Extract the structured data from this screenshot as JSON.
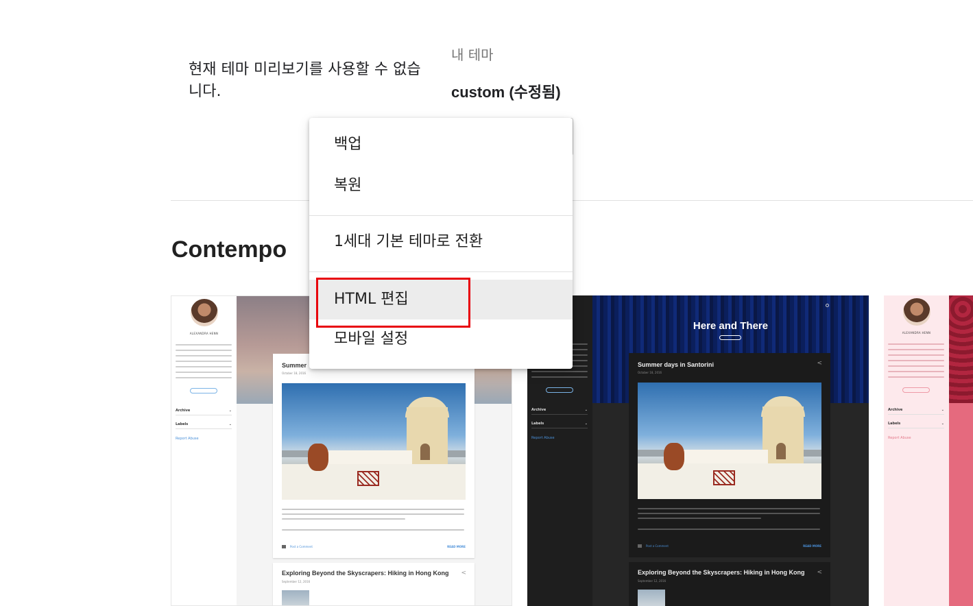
{
  "current_theme": {
    "no_preview_text": "현재 테마 미리보기를 사용할 수 없습니다.",
    "label": "내 테마",
    "name": "custom (수정됨)"
  },
  "theme_section": {
    "title": "Contempo"
  },
  "dropdown_menu": {
    "items": [
      {
        "label": "백업",
        "highlighted": false
      },
      {
        "label": "복원",
        "highlighted": false
      },
      {
        "label": "1세대 기본 테마로 전환",
        "highlighted": false
      },
      {
        "label": "HTML 편집",
        "highlighted": true
      },
      {
        "label": "모바일 설정",
        "highlighted": false
      }
    ]
  },
  "thumbnails": {
    "author_name": "ALEXANDRA HENN",
    "sidebar_archive": "Archive",
    "sidebar_labels": "Labels",
    "sidebar_report": "Report Abuse",
    "post_1_title_light": "Summer",
    "post_1_title": "Summer days in Santorini",
    "post_1_date": "October 18, 2016",
    "post_2_title": "Exploring Beyond the Skyscrapers: Hiking in Hong Kong",
    "post_2_date": "September 12, 2016",
    "dark_blog_title": "Here and There",
    "comment_link": "Post a Comment",
    "read_more": "READ MORE"
  },
  "colors": {
    "highlight_border": "#e8000b",
    "menu_active_bg": "#ececec",
    "link_blue": "#4a90d9"
  }
}
